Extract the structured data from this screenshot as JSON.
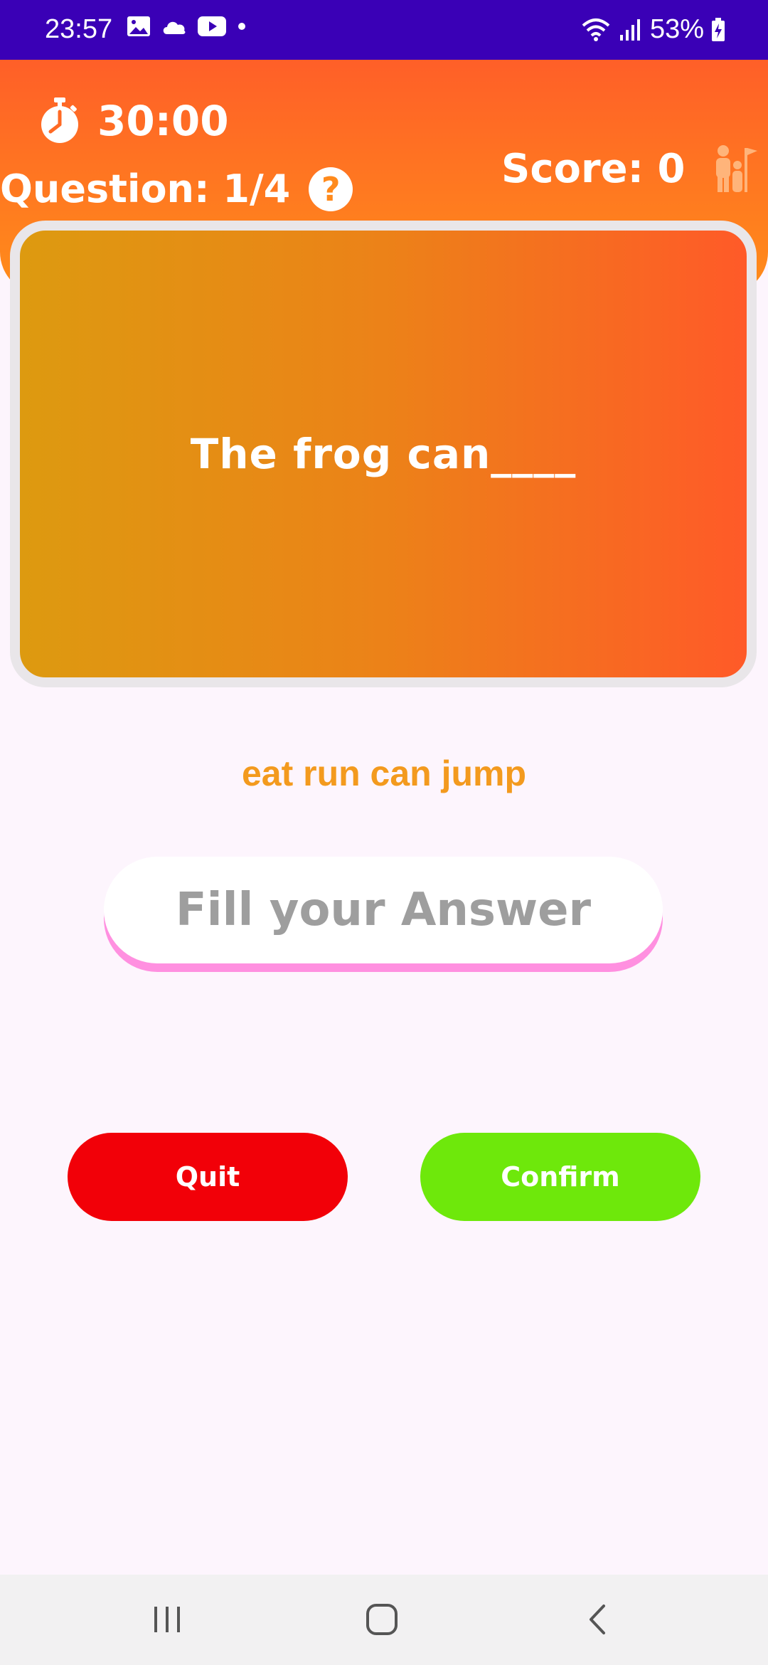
{
  "status_bar": {
    "time": "23:57",
    "battery": "53%"
  },
  "header": {
    "timer": "30:00",
    "question_label": "Question: 1/4",
    "help_symbol": "?",
    "score_label": "Score: 0"
  },
  "question": {
    "text": "The frog can____"
  },
  "options": {
    "text": "eat run can jump"
  },
  "answer": {
    "value": "",
    "placeholder": "Fill your Answer"
  },
  "buttons": {
    "quit": "Quit",
    "confirm": "Confirm"
  },
  "colors": {
    "status_bar": "#3a00b6",
    "header_top": "#ff5f28",
    "header_bottom": "#ff8d1a",
    "options_text": "#f39a1e",
    "quit": "#f20008",
    "confirm": "#6ee80b",
    "answer_shadow": "#ff90e0"
  },
  "icons": {
    "status_left": [
      "image-icon",
      "cloud-icon",
      "youtube-icon",
      "dot-icon"
    ],
    "status_right": [
      "wifi-icon",
      "signal-icon",
      "battery-charging-icon"
    ],
    "timer": "stopwatch-icon",
    "help": "help-icon",
    "score": "family-icon",
    "nav": [
      "recents-icon",
      "home-icon",
      "back-icon"
    ]
  }
}
